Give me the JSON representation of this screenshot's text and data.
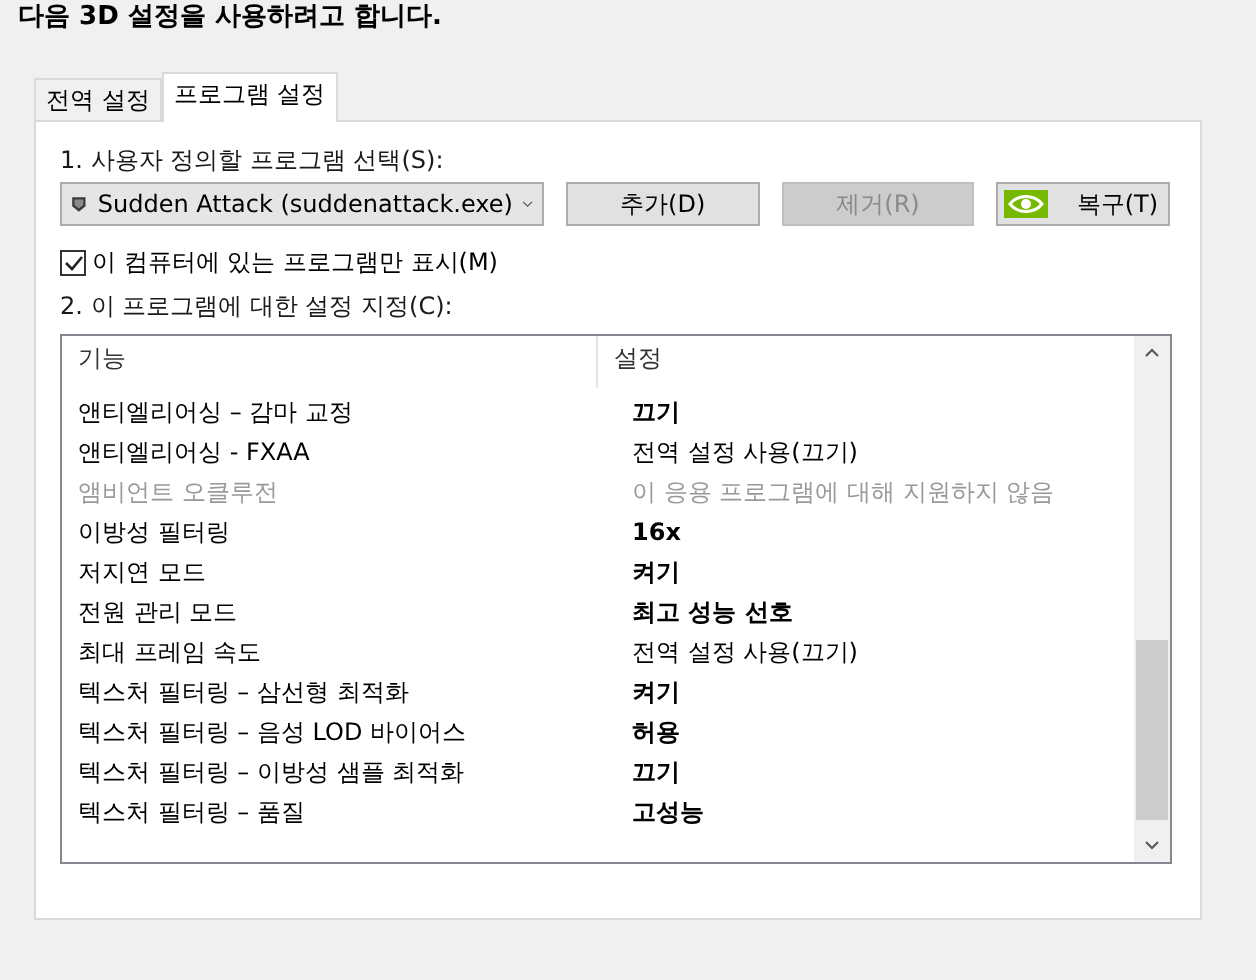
{
  "heading": "다음 3D 설정을 사용하려고 합니다.",
  "tabs": [
    {
      "label": "전역 설정",
      "selected": false
    },
    {
      "label": "프로그램 설정",
      "selected": true
    }
  ],
  "step1_label": "1. 사용자 정의할 프로그램 선택(S):",
  "program_select": {
    "value": "Sudden Attack (suddenattack.exe)"
  },
  "buttons": [
    {
      "label": "추가(D)",
      "disabled": false,
      "kind": "plain"
    },
    {
      "label": "제거(R)",
      "disabled": true,
      "kind": "plain"
    },
    {
      "label": "복구(T)",
      "disabled": false,
      "kind": "logo"
    }
  ],
  "show_only_installed": {
    "label": "이 컴퓨터에 있는 프로그램만 표시(M)",
    "checked": true
  },
  "step2_label": "2. 이 프로그램에 대한 설정 지정(C):",
  "table": {
    "columns": [
      "기능",
      "설정"
    ],
    "rows": [
      {
        "feature": "앤티엘리어싱 – 감마 교정",
        "setting": "끄기",
        "kind": "custom"
      },
      {
        "feature": "앤티엘리어싱 - FXAA",
        "setting": "전역 설정 사용(끄기)",
        "kind": "global"
      },
      {
        "feature": "앰비언트 오클루전",
        "setting": "이 응용 프로그램에 대해 지원하지 않음",
        "kind": "unsupported"
      },
      {
        "feature": "이방성 필터링",
        "setting": "16x",
        "kind": "custom"
      },
      {
        "feature": "저지연 모드",
        "setting": "켜기",
        "kind": "custom"
      },
      {
        "feature": "전원 관리 모드",
        "setting": "최고 성능 선호",
        "kind": "custom"
      },
      {
        "feature": "최대 프레임 속도",
        "setting": "전역 설정 사용(끄기)",
        "kind": "global"
      },
      {
        "feature": "텍스처 필터링 – 삼선형 최적화",
        "setting": "켜기",
        "kind": "custom"
      },
      {
        "feature": "텍스처 필터링 – 음성 LOD 바이어스",
        "setting": "허용",
        "kind": "custom"
      },
      {
        "feature": "텍스처 필터링 – 이방성 샘플 최적화",
        "setting": "끄기",
        "kind": "custom"
      },
      {
        "feature": "텍스처 필터링 – 품질",
        "setting": "고성능",
        "kind": "custom"
      }
    ]
  }
}
